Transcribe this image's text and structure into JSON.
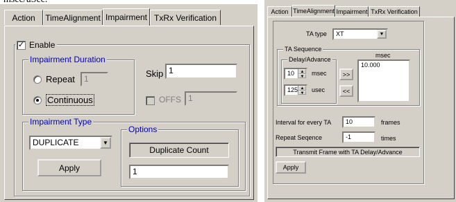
{
  "top_text": "msec/uSec.",
  "left": {
    "tabs": [
      "Action",
      "TimeAlignment",
      "Impairment",
      "TxRx Verification"
    ],
    "enable_label": "Enable",
    "enable_checked": true,
    "duration": {
      "title": "Impairment Duration",
      "repeat_label": "Repeat",
      "repeat_value": "1",
      "continuous_label": "Continuous",
      "selected": "Continuous"
    },
    "skip_label": "Skip",
    "skip_value": "1",
    "offs_label": "OFFS",
    "offs_value": "1",
    "type": {
      "title": "Impairment Type",
      "selected": "DUPLICATE",
      "apply_label": "Apply"
    },
    "options": {
      "title": "Options",
      "count_label": "Duplicate Count",
      "count_value": "1"
    }
  },
  "right": {
    "tabs": [
      "Action",
      "TimeAlignment",
      "Impairment",
      "TxRx Verification"
    ],
    "ta_type_label": "TA type",
    "ta_type_value": "XT",
    "ta_sequence": {
      "title": "TA Sequence",
      "delay_title": "Delay/Advance",
      "msec_value": "10",
      "msec_label": "msec",
      "usec_value": "125",
      "usec_label": "usec",
      "add_button": ">>",
      "remove_button": "<<",
      "list_header": "msec",
      "list_items": [
        "10.000"
      ]
    },
    "interval_label": "Interval for every TA",
    "interval_value": "10",
    "interval_unit": "frames",
    "repeat_label": "Repeat Seqence",
    "repeat_value": "-1",
    "repeat_unit": "times",
    "transmit_label": "Transmit Frame with TA Delay/Advance",
    "apply_label": "Apply"
  }
}
